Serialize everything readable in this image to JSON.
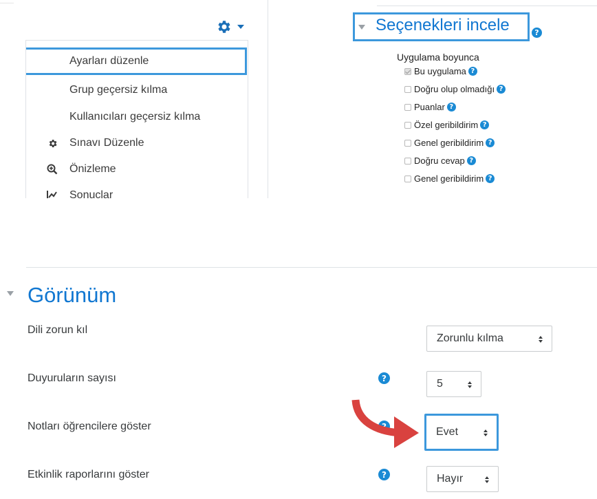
{
  "top_left_menu": {
    "items": [
      {
        "label": "Ayarları düzenle",
        "icon": "",
        "selected": true
      },
      {
        "label": "Grup geçersiz kılma",
        "icon": "",
        "selected": false
      },
      {
        "label": "Kullanıcıları geçersiz kılma",
        "icon": "",
        "selected": false
      },
      {
        "label": "Sınavı Düzenle",
        "icon": "gear-icon",
        "selected": false
      },
      {
        "label": "Önizleme",
        "icon": "zoom-in-icon",
        "selected": false
      },
      {
        "label": "Sonuçlar",
        "icon": "chart-icon",
        "selected": false
      }
    ]
  },
  "review_options": {
    "title": "Seçenekleri incele",
    "subtitle": "Uygulama boyunca",
    "options": [
      {
        "label": "Bu uygulama",
        "checked": true
      },
      {
        "label": "Doğru olup olmadığı",
        "checked": false
      },
      {
        "label": "Puanlar",
        "checked": false
      },
      {
        "label": "Özel geribildirim",
        "checked": false
      },
      {
        "label": "Genel geribildirim",
        "checked": false
      },
      {
        "label": "Doğru cevap",
        "checked": false
      },
      {
        "label": "Genel geribildirim",
        "checked": false
      }
    ]
  },
  "appearance": {
    "title": "Görünüm",
    "fields": [
      {
        "label": "Dili zorun kıl",
        "value": "Zorunlu kılma"
      },
      {
        "label": "Duyuruların sayısı",
        "value": "5"
      },
      {
        "label": "Notları öğrencilere göster",
        "value": "Evet"
      },
      {
        "label": "Etkinlik raporlarını göster",
        "value": "Hayır"
      }
    ]
  },
  "colors": {
    "accent": "#1177d1",
    "highlight_border": "#3c98dc",
    "arrow": "#d9423f"
  }
}
